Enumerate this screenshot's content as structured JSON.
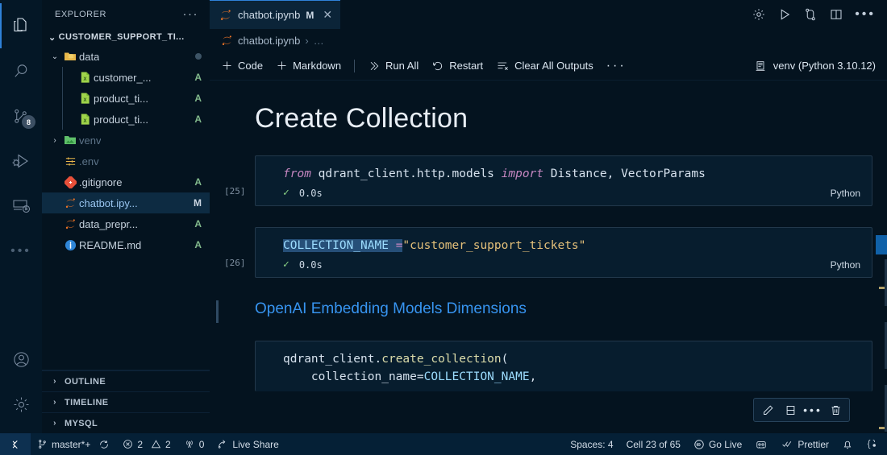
{
  "activitybar": {
    "items": [
      {
        "name": "explorer",
        "icon": "files-icon",
        "active": true
      },
      {
        "name": "search",
        "icon": "search-icon",
        "active": false
      },
      {
        "name": "source-control",
        "icon": "source-control-icon",
        "active": false,
        "badge": "8"
      },
      {
        "name": "run-debug",
        "icon": "run-and-debug-icon",
        "active": false
      },
      {
        "name": "remote-explorer",
        "icon": "remote-explorer-icon",
        "active": false
      },
      {
        "name": "more-views",
        "icon": "ellipsis-icon",
        "active": false
      }
    ],
    "bottom": [
      {
        "name": "account",
        "icon": "account-icon"
      },
      {
        "name": "manage",
        "icon": "gear-icon"
      }
    ]
  },
  "sidebar": {
    "title": "EXPLORER",
    "more_label": "···",
    "root_label": "CUSTOMER_SUPPORT_TI...",
    "tree": [
      {
        "label": "data",
        "icon": "folder-data-icon",
        "indent": 1,
        "twisty": "⌄",
        "status": "",
        "dim": false,
        "selected": false,
        "deco": true
      },
      {
        "label": "customer_...",
        "icon": "csv-file-icon",
        "indent": 2,
        "twisty": "",
        "status": "A",
        "dim": false,
        "selected": false,
        "deco": false
      },
      {
        "label": "product_ti...",
        "icon": "csv-file-icon",
        "indent": 2,
        "twisty": "",
        "status": "A",
        "dim": false,
        "selected": false,
        "deco": false
      },
      {
        "label": "product_ti...",
        "icon": "csv-file-icon",
        "indent": 2,
        "twisty": "",
        "status": "A",
        "dim": false,
        "selected": false,
        "deco": false
      },
      {
        "label": "venv",
        "icon": "folder-venv-icon",
        "indent": 1,
        "twisty": "›",
        "status": "",
        "dim": true,
        "selected": false,
        "deco": false
      },
      {
        "label": ".env",
        "icon": "env-file-icon",
        "indent": 1,
        "twisty": "",
        "status": "",
        "dim": true,
        "selected": false,
        "deco": false
      },
      {
        "label": ".gitignore",
        "icon": "git-file-icon",
        "indent": 1,
        "twisty": "",
        "status": "A",
        "dim": false,
        "selected": false,
        "deco": false
      },
      {
        "label": "chatbot.ipy...",
        "icon": "jupyter-file-icon",
        "indent": 1,
        "twisty": "",
        "status": "M",
        "dim": false,
        "selected": true,
        "deco": false
      },
      {
        "label": "data_prepr...",
        "icon": "jupyter-file-icon",
        "indent": 1,
        "twisty": "",
        "status": "A",
        "dim": false,
        "selected": false,
        "deco": false
      },
      {
        "label": "README.md",
        "icon": "readme-file-icon",
        "indent": 1,
        "twisty": "",
        "status": "A",
        "dim": false,
        "selected": false,
        "deco": false
      }
    ],
    "sections": [
      {
        "label": "OUTLINE",
        "twisty": "›"
      },
      {
        "label": "TIMELINE",
        "twisty": "›"
      },
      {
        "label": "MYSQL",
        "twisty": "›"
      }
    ]
  },
  "tabs": [
    {
      "label": "chatbot.ipynb",
      "dirty": "M",
      "close": "✕",
      "icon": "jupyter-file-icon",
      "active": true
    }
  ],
  "title_actions": [
    {
      "name": "settings-gear",
      "icon": "gear-icon"
    },
    {
      "name": "run-notebook",
      "icon": "play-icon"
    },
    {
      "name": "run-by-line",
      "icon": "source-control-icon"
    },
    {
      "name": "split-editor",
      "icon": "split-editor-icon"
    },
    {
      "name": "more-actions",
      "icon": "ellipsis-icon"
    }
  ],
  "breadcrumb": {
    "file": "chatbot.ipynb",
    "separator": "›",
    "tail": "…"
  },
  "notebook_toolbar": {
    "add_code": "Code",
    "add_markdown": "Markdown",
    "run_all": "Run All",
    "restart": "Restart",
    "clear_all_outputs": "Clear All Outputs",
    "more": "···",
    "kernel": "venv (Python 3.10.12)"
  },
  "notebook": {
    "heading": "Create Collection",
    "markdown_heading": "OpenAI Embedding Models Dimensions",
    "cells": [
      {
        "exec_count": "[25]",
        "status_check": "✓",
        "duration": "0.0s",
        "language": "Python",
        "code_tokens": [
          {
            "t": "from",
            "c": "kw"
          },
          {
            "t": " ",
            "c": "plain"
          },
          {
            "t": "qdrant_client.http.models",
            "c": "plain"
          },
          {
            "t": " ",
            "c": "plain"
          },
          {
            "t": "import",
            "c": "kw"
          },
          {
            "t": " ",
            "c": "plain"
          },
          {
            "t": "Distance, VectorParams",
            "c": "plain"
          }
        ]
      },
      {
        "exec_count": "[26]",
        "status_check": "✓",
        "duration": "0.0s",
        "language": "Python",
        "code_tokens": [
          {
            "t": "COLLECTION_NAME ",
            "c": "var sel-hl"
          },
          {
            "t": "=",
            "c": "op sel-hl"
          },
          {
            "t": "\"customer_support_tickets\"",
            "c": "str"
          }
        ]
      }
    ],
    "bottom_cell": {
      "line1_tokens": [
        {
          "t": "qdrant_client",
          "c": "plain"
        },
        {
          "t": ".",
          "c": "plain"
        },
        {
          "t": "create_collection",
          "c": "fn"
        },
        {
          "t": "(",
          "c": "plain"
        }
      ],
      "line2_tokens": [
        {
          "t": "    collection_name=",
          "c": "plain"
        },
        {
          "t": "COLLECTION_NAME",
          "c": "var"
        },
        {
          "t": ",",
          "c": "plain"
        }
      ]
    }
  },
  "cell_toolbar": [
    {
      "name": "edit-cell-button",
      "icon": "pencil-icon"
    },
    {
      "name": "split-cell-button",
      "icon": "split-cell-icon"
    },
    {
      "name": "more-cell-actions",
      "icon": "ellipsis-icon"
    },
    {
      "name": "delete-cell-button",
      "icon": "trash-icon"
    }
  ],
  "statusbar": {
    "remote_icon": "remote-window-icon",
    "branch": "master*+",
    "sync_icon": "sync-icon",
    "errors": "2",
    "warnings": "2",
    "ports": "0",
    "live_share": "Live Share",
    "spaces": "Spaces: 4",
    "cell_position": "Cell 23 of 65",
    "go_live": "Go Live",
    "prettier": "Prettier",
    "bell_icon": "bell-icon",
    "brackets_icon": "brackets-icon",
    "gitlens_icon": "gitlens-icon"
  },
  "colors": {
    "accent": "#2f81d8",
    "background": "#04131f",
    "sidebar_bg": "#04131f",
    "statusbar_bg": "#052036",
    "selection": "#264f78",
    "git_added": "#81b88b",
    "heading_link": "#3794f0"
  }
}
